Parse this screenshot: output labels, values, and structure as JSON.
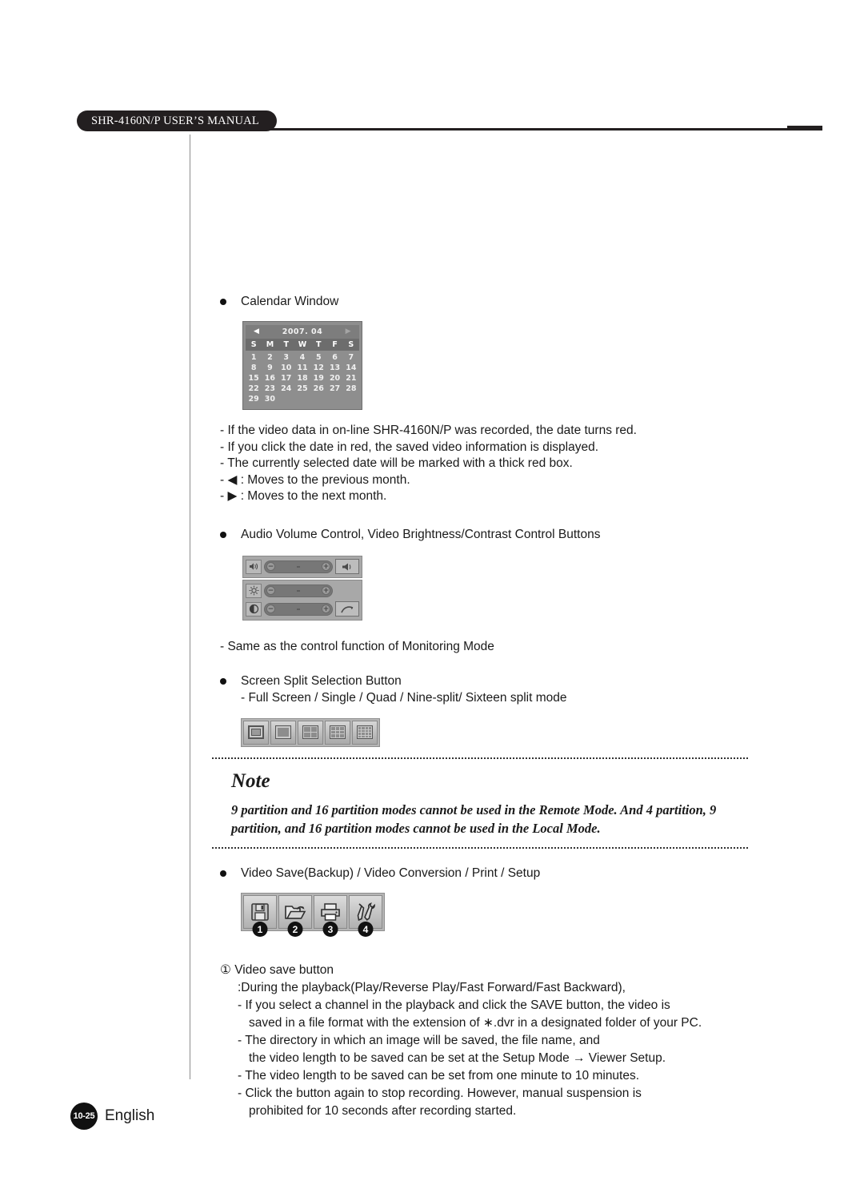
{
  "header": {
    "manual_title": "SHR-4160N/P USER’S MANUAL"
  },
  "sections": {
    "calendar": {
      "bullet_label": "Calendar Window",
      "widget": {
        "prev_arrow": "◀",
        "next_arrow": "▶",
        "year_month": "2007.  04",
        "day_headers": [
          "S",
          "M",
          "T",
          "W",
          "T",
          "F",
          "S"
        ],
        "leading_blanks": 0,
        "dates": [
          1,
          2,
          3,
          4,
          5,
          6,
          7,
          8,
          9,
          10,
          11,
          12,
          13,
          14,
          15,
          16,
          17,
          18,
          19,
          20,
          21,
          22,
          23,
          24,
          25,
          26,
          27,
          28,
          29,
          30
        ]
      },
      "notes": [
        "- If the video data in on-line SHR-4160N/P was recorded, the date turns red.",
        "- If you click the date in red, the saved video information is displayed.",
        "- The currently selected date will be marked with a thick red box.",
        "- ◀ : Moves to the previous month.",
        "- ▶ : Moves to the next month."
      ]
    },
    "av_control": {
      "bullet_label": "Audio Volume Control, Video Brightness/Contrast Control Buttons",
      "rows": [
        {
          "icon": "speaker-icon",
          "minus": "−",
          "plus": "+",
          "button_icon": "speaker-mute-icon"
        },
        {
          "icon": "brightness-icon",
          "minus": "−",
          "plus": "+",
          "button_icon": "none"
        },
        {
          "icon": "contrast-icon",
          "minus": "−",
          "plus": "+",
          "button_icon": "reset-arrow-icon"
        }
      ],
      "note": "- Same as the control function of Monitoring Mode"
    },
    "screen_split": {
      "bullet_label": "Screen Split Selection Button",
      "note": "- Full Screen / Single / Quad / Nine-split/ Sixteen split mode",
      "buttons": [
        {
          "name": "full-screen",
          "grid": "full"
        },
        {
          "name": "single",
          "grid": "single"
        },
        {
          "name": "quad",
          "grid": 2
        },
        {
          "name": "nine-split",
          "grid": 3
        },
        {
          "name": "sixteen-split",
          "grid": 4
        }
      ]
    },
    "note_box": {
      "title": "Note",
      "body": "9 partition and 16 partition modes cannot be used in the Remote Mode. And 4 partition, 9 partition, and 16 partition modes cannot be used in the Local Mode."
    },
    "video_save": {
      "bullet_label": "Video Save(Backup) / Video Conversion / Print / Setup",
      "buttons": [
        {
          "number": "1",
          "icon": "floppy-save-icon"
        },
        {
          "number": "2",
          "icon": "open-folder-icon"
        },
        {
          "number": "3",
          "icon": "printer-icon"
        },
        {
          "number": "4",
          "icon": "tools-setup-icon"
        }
      ],
      "lines": [
        "① Video save button",
        ":During the playback(Play/Reverse Play/Fast Forward/Fast Backward),",
        "- If you select a channel in the playback and click the SAVE button, the video is",
        "saved in a file format with the extension of ∗.dvr in a designated folder of your PC.",
        "- The directory in which an image will be saved, the file name, and",
        "the video length to be saved can be set at the Setup Mode → Viewer Setup.",
        "- The video length to be saved can be set from one minute to 10 minutes.",
        "- Click the button again to stop recording. However, manual suspension is",
        "prohibited for 10 seconds after recording started."
      ]
    }
  },
  "footer": {
    "page_number": "10-25",
    "language": "English"
  }
}
